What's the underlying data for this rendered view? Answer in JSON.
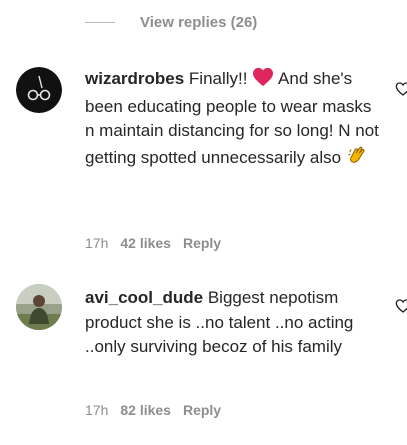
{
  "replies": {
    "label": "View replies (26)"
  },
  "comments": [
    {
      "username": "wizardrobes",
      "text_a": " Finally!! ",
      "text_b": " And she's been educating people to wear masks n maintain distancing for so long! N not getting spotted unnecessarily also ",
      "time": "17h",
      "likes": "42 likes",
      "reply": "Reply"
    },
    {
      "username": "avi_cool_dude",
      "text": " Biggest nepotism product she is ..no talent ..no acting ..only surviving becoz of his family",
      "time": "17h",
      "likes": "82 likes",
      "reply": "Reply"
    }
  ],
  "icons": {
    "like": "heart-outline-icon",
    "emoji_1": "red-heart-emoji",
    "emoji_2": "clapping-hands-emoji"
  },
  "colors": {
    "text": "#262626",
    "muted": "#8e8e8e",
    "heart_emoji": "#e0245e",
    "clap_emoji": "#f5b400"
  }
}
